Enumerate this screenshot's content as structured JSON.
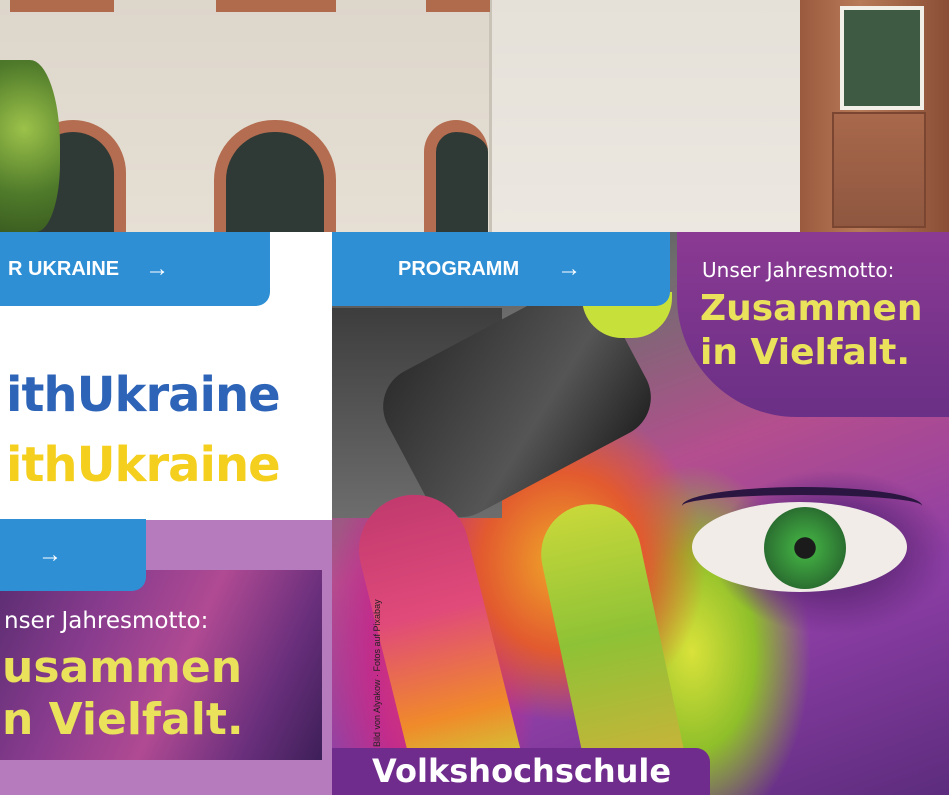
{
  "left_poster": {
    "cta_label": "R UKRAINE",
    "cta_arrow": "→",
    "hashtag_line1": "ithUkraine",
    "hashtag_line2": "ithUkraine",
    "cta2_arrow": "→",
    "motto_small": "nser Jahresmotto:",
    "motto_line1": "usammen",
    "motto_line2": "n Vielfalt."
  },
  "right_poster": {
    "cta_label": "PROGRAMM",
    "cta_arrow": "→",
    "motto_small": "Unser Jahresmotto:",
    "motto_line1": "Zusammen",
    "motto_line2": "in Vielfalt.",
    "photo_credit": "Bild von Alyakow · Fotos auf Pixabay",
    "footer_label": "Volkshochschule"
  },
  "colors": {
    "button_blue": "#2f8fd4",
    "ukraine_blue": "#2d64b8",
    "ukraine_yellow": "#f4cf1d",
    "motto_yellow": "#e9e25a",
    "vhs_purple": "#6f2c8c"
  }
}
